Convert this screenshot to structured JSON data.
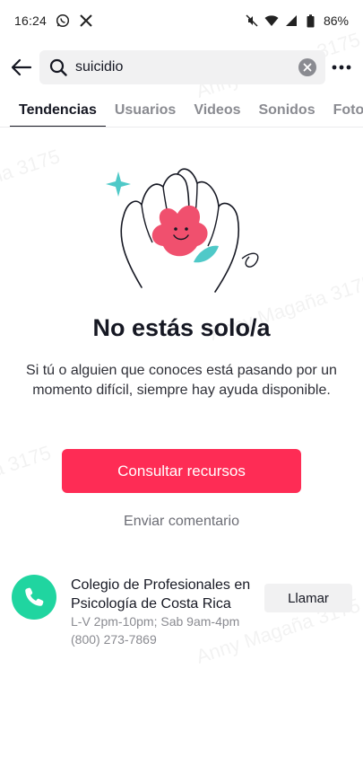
{
  "status_bar": {
    "time": "16:24",
    "battery": "86%",
    "icons_left": [
      "whatsapp-icon",
      "x-icon"
    ],
    "icons_right": [
      "mute-icon",
      "wifi-icon",
      "signal-icon",
      "battery-icon"
    ]
  },
  "search": {
    "value": "suicidio"
  },
  "tabs": [
    {
      "label": "Tendencias",
      "active": true
    },
    {
      "label": "Usuarios",
      "active": false
    },
    {
      "label": "Videos",
      "active": false
    },
    {
      "label": "Sonidos",
      "active": false
    },
    {
      "label": "Fotos",
      "active": false
    }
  ],
  "message": {
    "title": "No estás solo/a",
    "body": "Si tú o alguien que conoces está pasando por un momento difícil, siempre hay ayuda disponible."
  },
  "actions": {
    "primary_label": "Consultar recursos",
    "secondary_label": "Enviar comentario"
  },
  "contact": {
    "name": "Colegio de Profesionales en Psicología de Costa Rica",
    "hours": "L-V 2pm-10pm; Sab 9am-4pm",
    "phone": "(800) 273-7869",
    "call_label": "Llamar"
  },
  "watermark": "Anny Magaña 3175",
  "colors": {
    "accent": "#fe2c55",
    "phone_green": "#20d5a0",
    "heart_pink": "#f0506e",
    "leaf_teal": "#4fc9c8"
  }
}
